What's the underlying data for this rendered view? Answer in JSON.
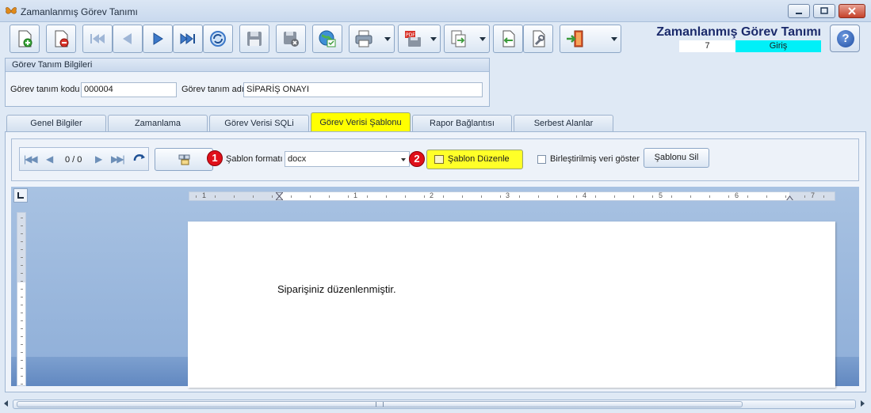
{
  "window": {
    "title": "Zamanlanmış Görev Tanımı",
    "app_icon": "butterfly-icon"
  },
  "toolbar": {
    "buttons": [
      {
        "name": "new-record",
        "icon": "new-document-icon"
      },
      {
        "name": "delete-record",
        "icon": "delete-document-icon"
      },
      {
        "name": "first",
        "icon": "first-record-icon"
      },
      {
        "name": "previous",
        "icon": "previous-record-icon"
      },
      {
        "name": "next",
        "icon": "next-record-icon"
      },
      {
        "name": "last",
        "icon": "last-record-icon"
      },
      {
        "name": "refresh",
        "icon": "refresh-icon"
      },
      {
        "name": "save",
        "icon": "save-icon"
      },
      {
        "name": "save-cancel",
        "icon": "save-cancel-icon"
      },
      {
        "name": "web",
        "icon": "globe-icon"
      },
      {
        "name": "print",
        "icon": "printer-icon"
      },
      {
        "name": "pdf",
        "icon": "pdf-icon"
      },
      {
        "name": "export",
        "icon": "export-icon"
      },
      {
        "name": "import",
        "icon": "import-icon"
      },
      {
        "name": "tools",
        "icon": "wrench-icon"
      },
      {
        "name": "exit",
        "icon": "exit-door-icon"
      }
    ]
  },
  "module": {
    "title": "Zamanlanmış Görev Tanımı",
    "record_no": "7",
    "mode": "Giriş"
  },
  "info": {
    "header": "Görev Tanım Bilgileri",
    "code_label": "Görev tanım kodu",
    "code_value": "000004",
    "name_label": "Görev tanım adı",
    "name_value": "SİPARİŞ ONAYI"
  },
  "tabs": [
    {
      "label": "Genel Bilgiler",
      "active": false
    },
    {
      "label": "Zamanlama",
      "active": false
    },
    {
      "label": "Görev Verisi SQLi",
      "active": false
    },
    {
      "label": "Görev Verisi Şablonu",
      "active": true
    },
    {
      "label": "Rapor Bağlantısı",
      "active": false
    },
    {
      "label": "Serbest Alanlar",
      "active": false
    }
  ],
  "template_bar": {
    "record_counter": "0 / 0",
    "badge_1": "1",
    "format_label": "Şablon formatı",
    "format_value": "docx",
    "badge_2": "2",
    "edit_button": "Şablon Düzenle",
    "merged_label": "Birleştirilmiş veri göster",
    "merged_checked": false,
    "delete_button": "Şablonu Sil"
  },
  "ruler": {
    "numbers": [
      "1",
      "1",
      "2",
      "3",
      "4",
      "5",
      "6",
      "7"
    ]
  },
  "document": {
    "text": "Siparişiniz düzenlenmiştir."
  },
  "colors": {
    "active_tab": "#ffff00",
    "mode_bg": "#00f0f8",
    "badge": "#e0101a",
    "title_text": "#1b2a6b"
  }
}
